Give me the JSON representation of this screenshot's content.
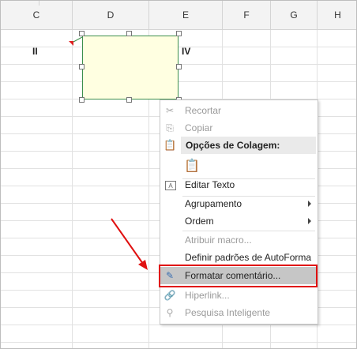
{
  "columns": [
    "C",
    "D",
    "E",
    "F",
    "G",
    "H"
  ],
  "cells": {
    "c_label": "II",
    "e_label": "IV"
  },
  "context_menu": {
    "items": [
      {
        "label": "Recortar",
        "icon": "scissors-icon",
        "disabled": true
      },
      {
        "label": "Copiar",
        "icon": "copy-icon",
        "disabled": true
      },
      {
        "label": "Opções de Colagem:",
        "icon": "paste-icon",
        "section": true
      },
      {
        "label": "",
        "icon": "paste-option-icon"
      },
      {
        "label": "Editar Texto",
        "icon": "edit-text-icon"
      },
      {
        "label": "Agrupamento",
        "submenu": true
      },
      {
        "label": "Ordem",
        "submenu": true
      },
      {
        "label": "Atribuir macro...",
        "disabled": true
      },
      {
        "label": "Definir padrões de AutoForma"
      },
      {
        "label": "Formatar comentário...",
        "icon": "format-comment-icon",
        "highlighted": true
      },
      {
        "label": "Hiperlink...",
        "icon": "hyperlink-icon",
        "disabled": true
      },
      {
        "label": "Pesquisa Inteligente",
        "icon": "smart-lookup-icon",
        "disabled": true
      }
    ]
  },
  "colors": {
    "comment_fill": "#ffffe1",
    "comment_border": "#3d8f4b",
    "highlight": "#e01010"
  }
}
